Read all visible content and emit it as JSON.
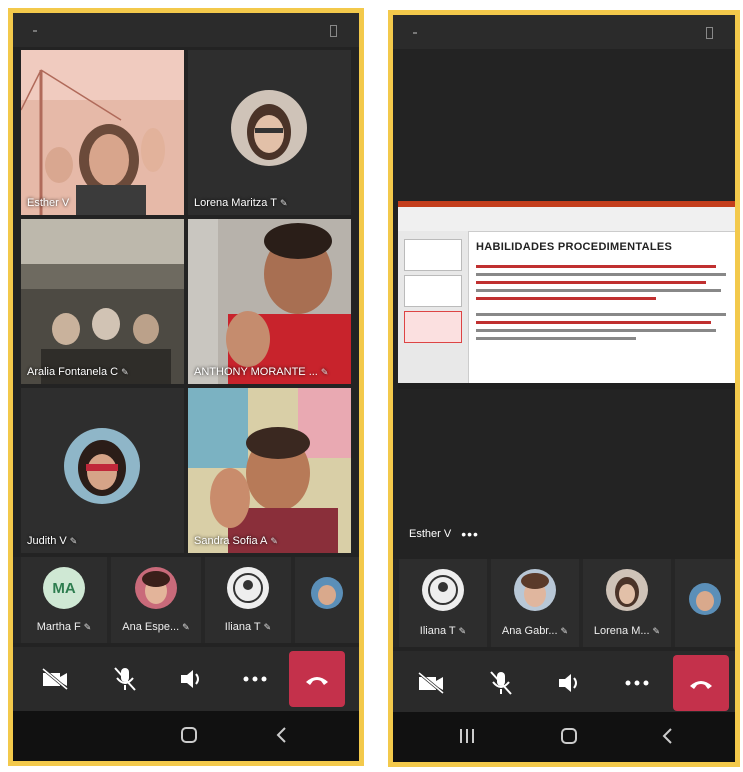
{
  "left_phone": {
    "tiles": [
      {
        "name": "Esther V",
        "mic": ""
      },
      {
        "name": "Lorena Maritza T",
        "mic": "✎"
      },
      {
        "name": "Aralia Fontanela C",
        "mic": "✎"
      },
      {
        "name": "ANTHONY MORANTE ...",
        "mic": "✎"
      },
      {
        "name": "Judith V",
        "mic": "✎"
      },
      {
        "name": "Sandra Sofia A",
        "mic": "✎"
      }
    ],
    "strip": [
      {
        "initials": "MA",
        "name": "Martha F",
        "mic": "✎"
      },
      {
        "name": "Ana Espe...",
        "mic": "✎"
      },
      {
        "name": "Iliana T",
        "mic": "✎"
      }
    ]
  },
  "right_phone": {
    "slide_heading": "HABILIDADES PROCEDIMENTALES",
    "presenter": "Esther V",
    "more": "•••",
    "strip": [
      {
        "name": "Iliana T",
        "mic": "✎"
      },
      {
        "name": "Ana Gabr...",
        "mic": "✎"
      },
      {
        "name": "Lorena M...",
        "mic": "✎"
      }
    ]
  },
  "colors": {
    "frame": "#f3c94b",
    "background": "#232323",
    "hangup": "#c4314b",
    "slide_accent": "#c43e1c"
  },
  "icons": [
    "video-off-icon",
    "mic-off-icon",
    "speaker-icon",
    "more-icon",
    "hangup-icon",
    "nav-home-icon",
    "nav-back-icon",
    "nav-recents-icon"
  ]
}
